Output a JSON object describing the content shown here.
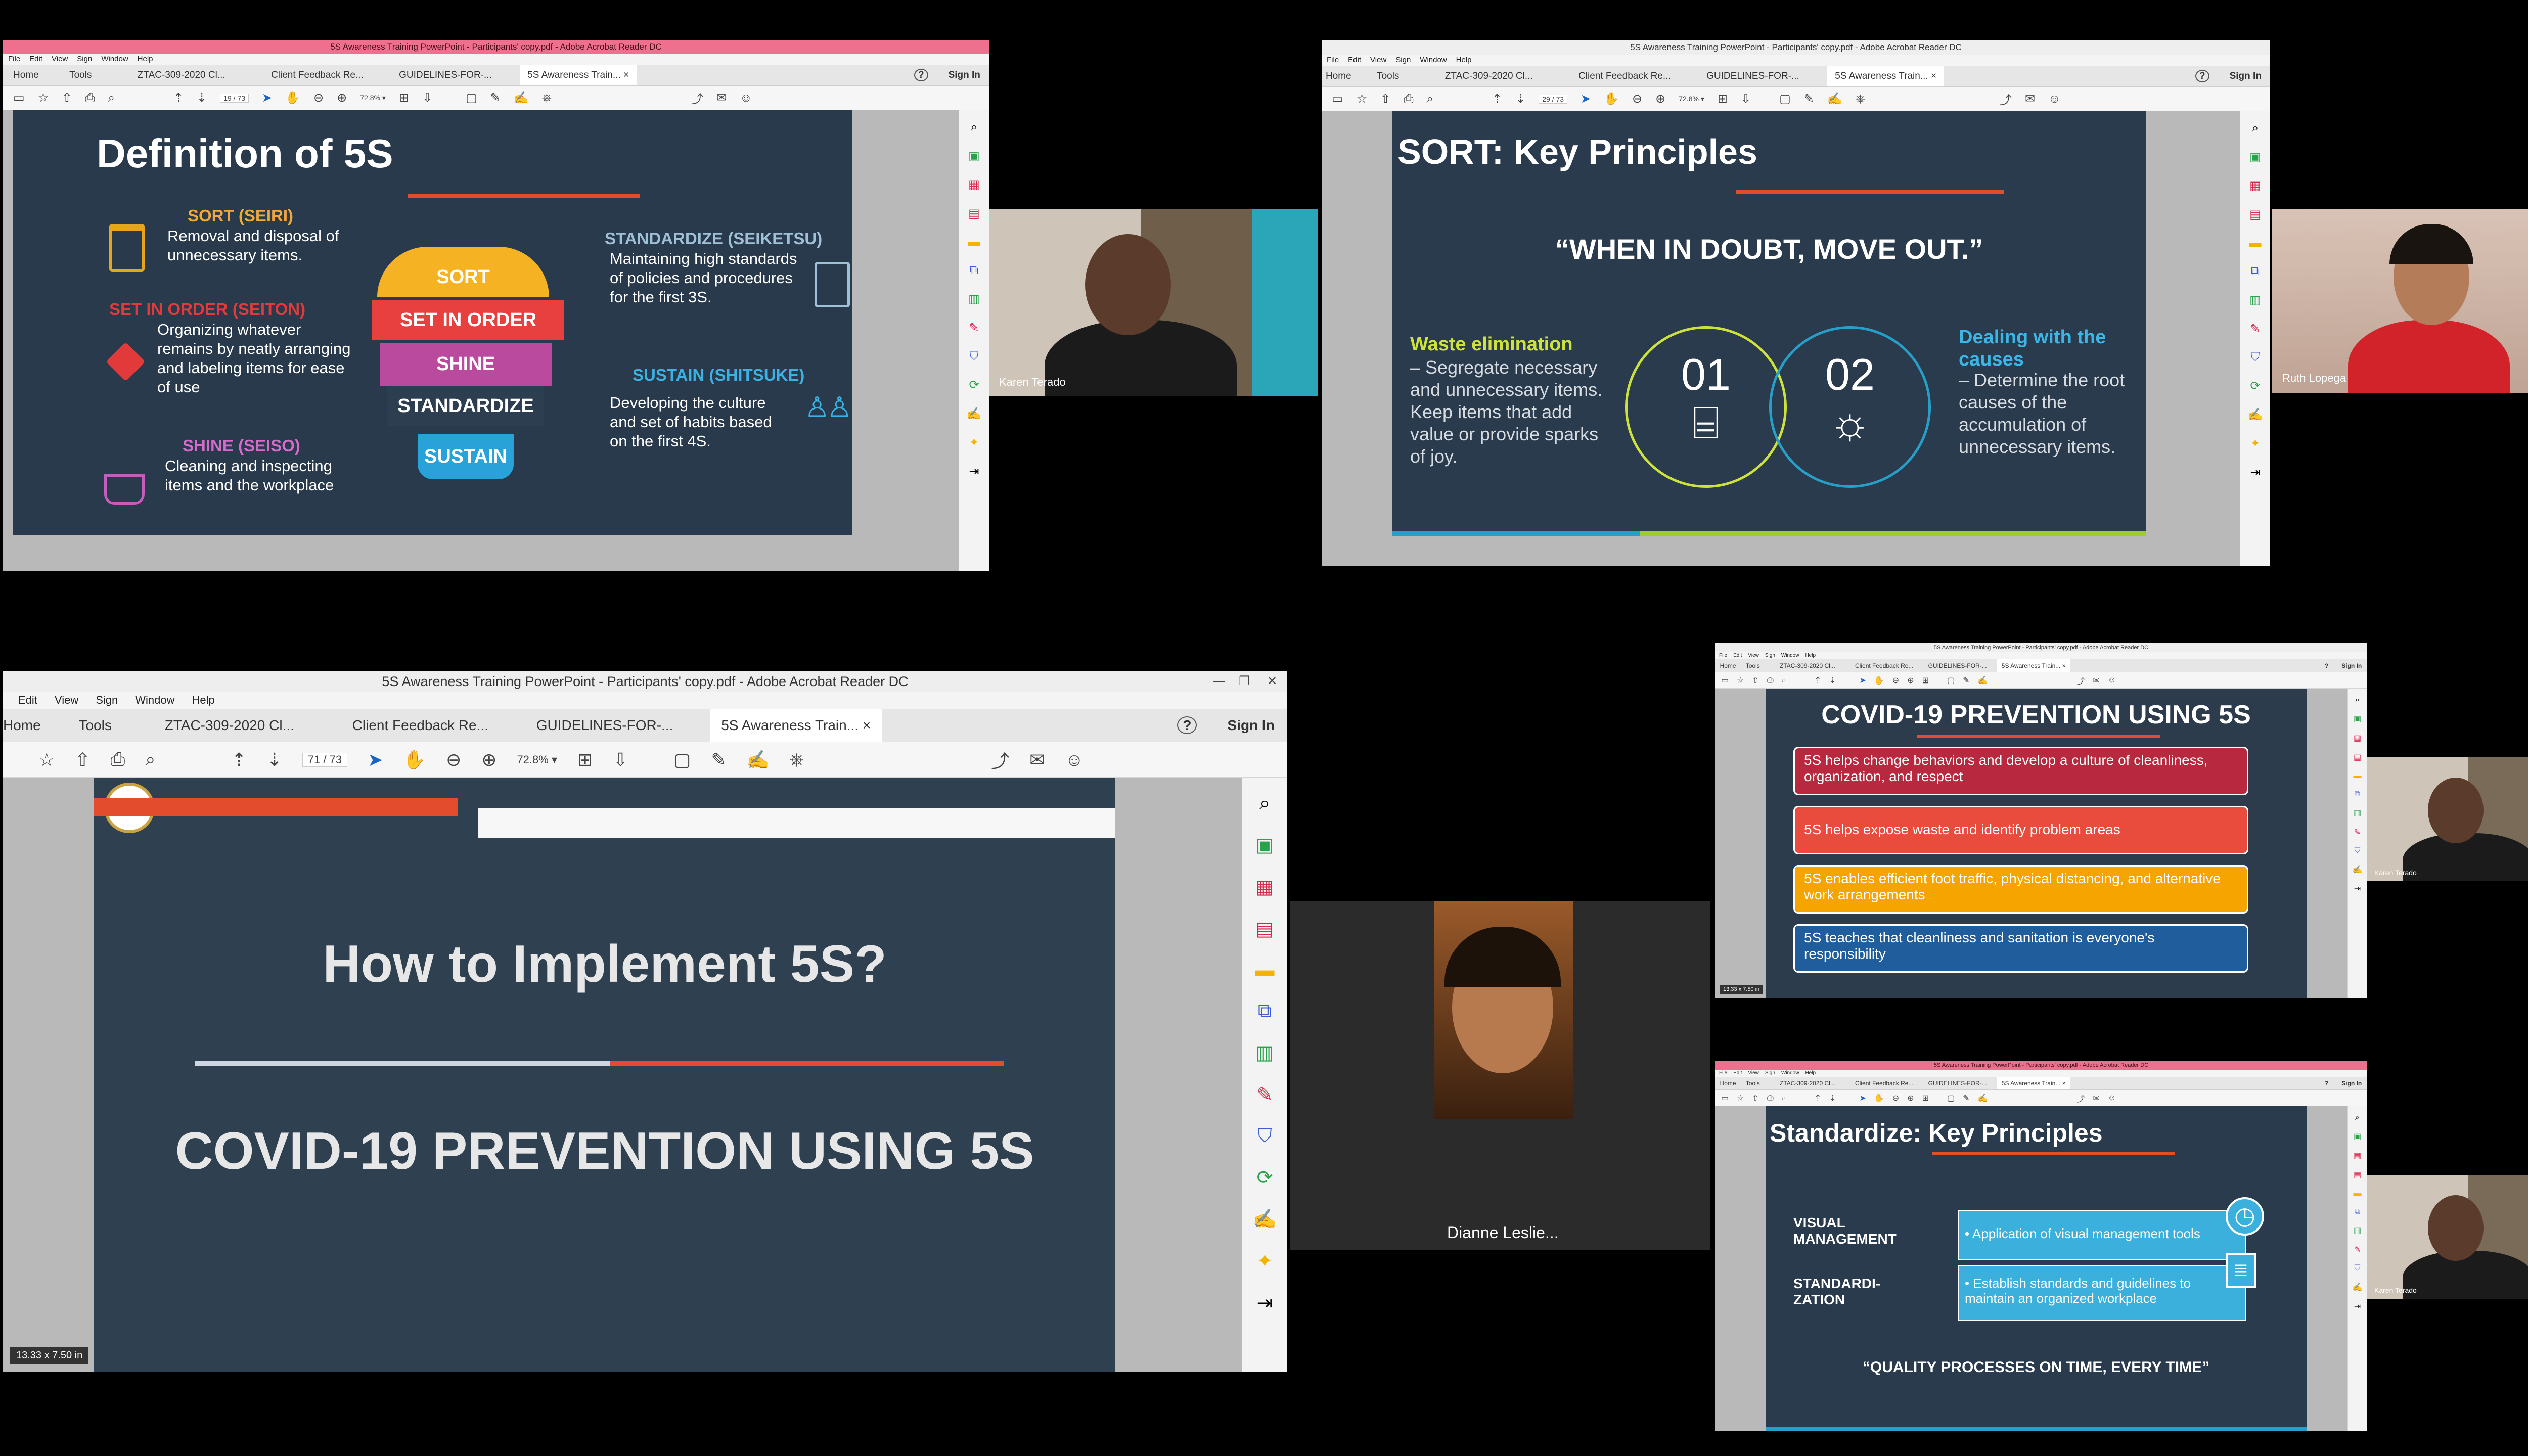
{
  "acrobat": {
    "window_title": "5S Awareness Training PowerPoint - Participants' copy.pdf - Adobe Acrobat Reader DC",
    "menu_items": [
      "File",
      "Edit",
      "View",
      "Sign",
      "Window",
      "Help"
    ],
    "menu_items_short": [
      "Edit",
      "View",
      "Sign",
      "Window",
      "Help"
    ],
    "tabs": [
      "Home",
      "Tools",
      "ZTAC-309-2020 Cl...",
      "Client Feedback Re...",
      "GUIDELINES-FOR-...",
      "5S Awareness Train..."
    ],
    "tab_close": "×",
    "sign_in": "Sign In",
    "help_icon": "?",
    "zoom": "72.8%",
    "page_total": "73"
  },
  "tiles": {
    "t1": {
      "page_num": "19",
      "slide": {
        "title": "Definition of 5S",
        "sort_h": "SORT (SEIRI)",
        "sort_b": "Removal and disposal of unnecessary items.",
        "seton_h": "SET IN ORDER (SEITON)",
        "seton_b": "Organizing whatever remains by neatly arranging and labeling items for ease of use",
        "shine_h": "SHINE (SEISO)",
        "shine_b": "Cleaning and inspecting items and the workplace",
        "std_h": "STANDARDIZE (SEIKETSU)",
        "std_b": "Maintaining high standards of policies and procedures for the first 3S.",
        "sus_h": "SUSTAIN (SHITSUKE)",
        "sus_b": "Developing the culture and set of habits based on the first 4S.",
        "bulb": [
          "SORT",
          "SET IN ORDER",
          "SHINE",
          "STANDARDIZE",
          "SUSTAIN"
        ]
      },
      "cam_name": "Karen Terado"
    },
    "t2": {
      "page_num": "29",
      "slide": {
        "title": "SORT: Key Principles",
        "quote": "“WHEN IN DOUBT, MOVE OUT.”",
        "left_h": "Waste elimination",
        "left_b": "– Segregate necessary and unnecessary items. Keep items that add value or provide sparks of joy.",
        "n1": "01",
        "n2": "02",
        "right_h": "Dealing with the causes",
        "right_b": "– Determine the root causes of the accumulation of unnecessary items."
      },
      "cam_name": "Ruth Lopega"
    },
    "t3": {
      "page_num": "71",
      "slide": {
        "line1": "How to Implement 5S?",
        "line2": "COVID-19 PREVENTION USING 5S"
      },
      "page_size": "13.33 x 7.50 in"
    },
    "t4": {
      "cam_name": "Dianne Leslie..."
    },
    "t5": {
      "slide": {
        "title": "COVID-19 PREVENTION USING 5S",
        "items": [
          "5S helps change behaviors and develop a culture of cleanliness, organization, and respect",
          "5S helps expose waste and identify problem areas",
          "5S enables efficient foot traffic, physical distancing, and alternative work arrangements",
          "5S teaches that cleanliness and sanitation is everyone's responsibility"
        ],
        "colors": [
          "#b8293f",
          "#e94b3c",
          "#f5a400",
          "#1f5d9c"
        ]
      },
      "cam_name": "Karen Terado",
      "page_size": "13.33 x 7.50 in"
    },
    "t6": {
      "slide": {
        "title": "Standardize: Key Principles",
        "vm_label": "VISUAL MANAGEMENT",
        "vm_text": "• Application of visual management tools",
        "std_label": "STANDARDI- ZATION",
        "std_text": "• Establish standards and guidelines to maintain an organized workplace",
        "footer": "“QUALITY PROCESSES ON TIME, EVERY TIME”"
      },
      "cam_name": "Karen Terado"
    }
  },
  "icons": [
    "star-icon",
    "upload-icon",
    "print-icon",
    "zoom-icon",
    "arrow-up-icon",
    "arrow-down-icon",
    "cursor-icon",
    "hand-icon",
    "zoom-out-icon",
    "zoom-in-icon",
    "comment-icon",
    "pen-icon",
    "sign-icon",
    "stamp-icon",
    "share-icon",
    "mail-icon",
    "user-icon"
  ]
}
